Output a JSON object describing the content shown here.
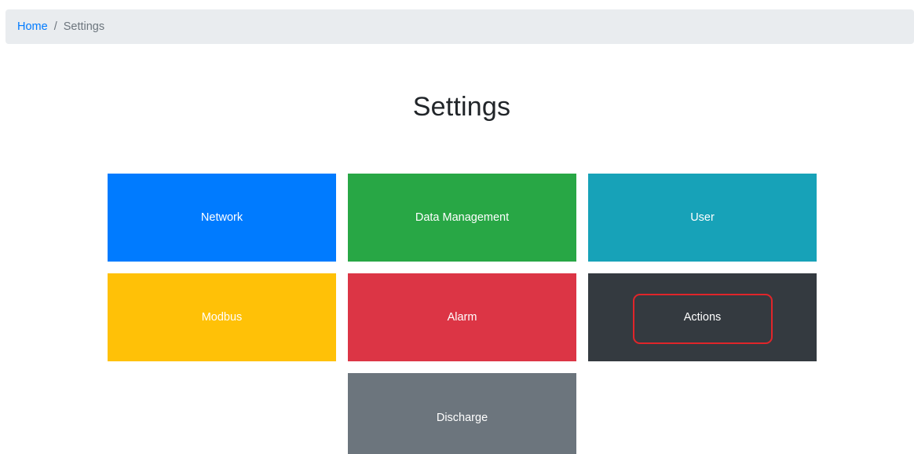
{
  "breadcrumb": {
    "home": "Home",
    "separator": "/",
    "current": "Settings"
  },
  "page": {
    "title": "Settings"
  },
  "tiles": {
    "network": "Network",
    "data_management": "Data Management",
    "user": "User",
    "modbus": "Modbus",
    "alarm": "Alarm",
    "actions": "Actions",
    "discharge": "Discharge"
  },
  "colors": {
    "network": "#007bff",
    "data_management": "#28a745",
    "user": "#17a2b8",
    "modbus": "#ffc107",
    "alarm": "#dc3545",
    "actions": "#343a40",
    "discharge": "#6c757d",
    "highlight": "#e0252a"
  }
}
